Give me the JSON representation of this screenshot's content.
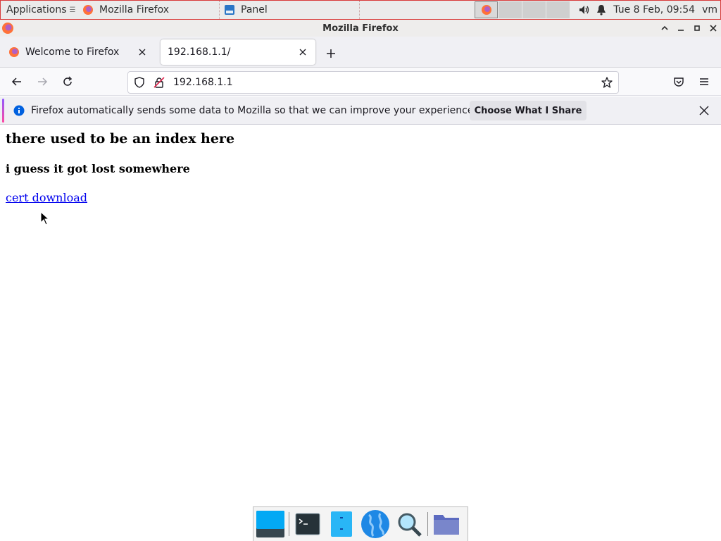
{
  "panel": {
    "applications_label": "Applications",
    "applications_glyph": "☰",
    "tasks": [
      {
        "label": "Mozilla Firefox",
        "icon": "firefox-icon"
      },
      {
        "label": "Panel",
        "icon": "panel-icon"
      }
    ],
    "workspaces": 4,
    "clock": "Tue  8 Feb, 09:54",
    "user": "vm"
  },
  "window": {
    "title": "Mozilla Firefox"
  },
  "tabs": [
    {
      "label": "Welcome to Firefox",
      "active": false
    },
    {
      "label": "192.168.1.1/",
      "active": true
    }
  ],
  "urlbar": {
    "value": "192.168.1.1"
  },
  "notification": {
    "message": "Firefox automatically sends some data to Mozilla so that we can improve your experience.",
    "button": "Choose What I Share"
  },
  "page": {
    "heading": "there used to be an index here",
    "subheading": "i guess it got lost somewhere",
    "link": "cert download"
  },
  "colors": {
    "link": "#0000ee",
    "accent_top": "#9059ff",
    "accent_bottom": "#ff4aa2",
    "info": "#0060df"
  },
  "dock": [
    "desktop-icon",
    "terminal-icon",
    "file-manager-icon",
    "web-browser-icon",
    "search-icon",
    "folder-icon"
  ]
}
